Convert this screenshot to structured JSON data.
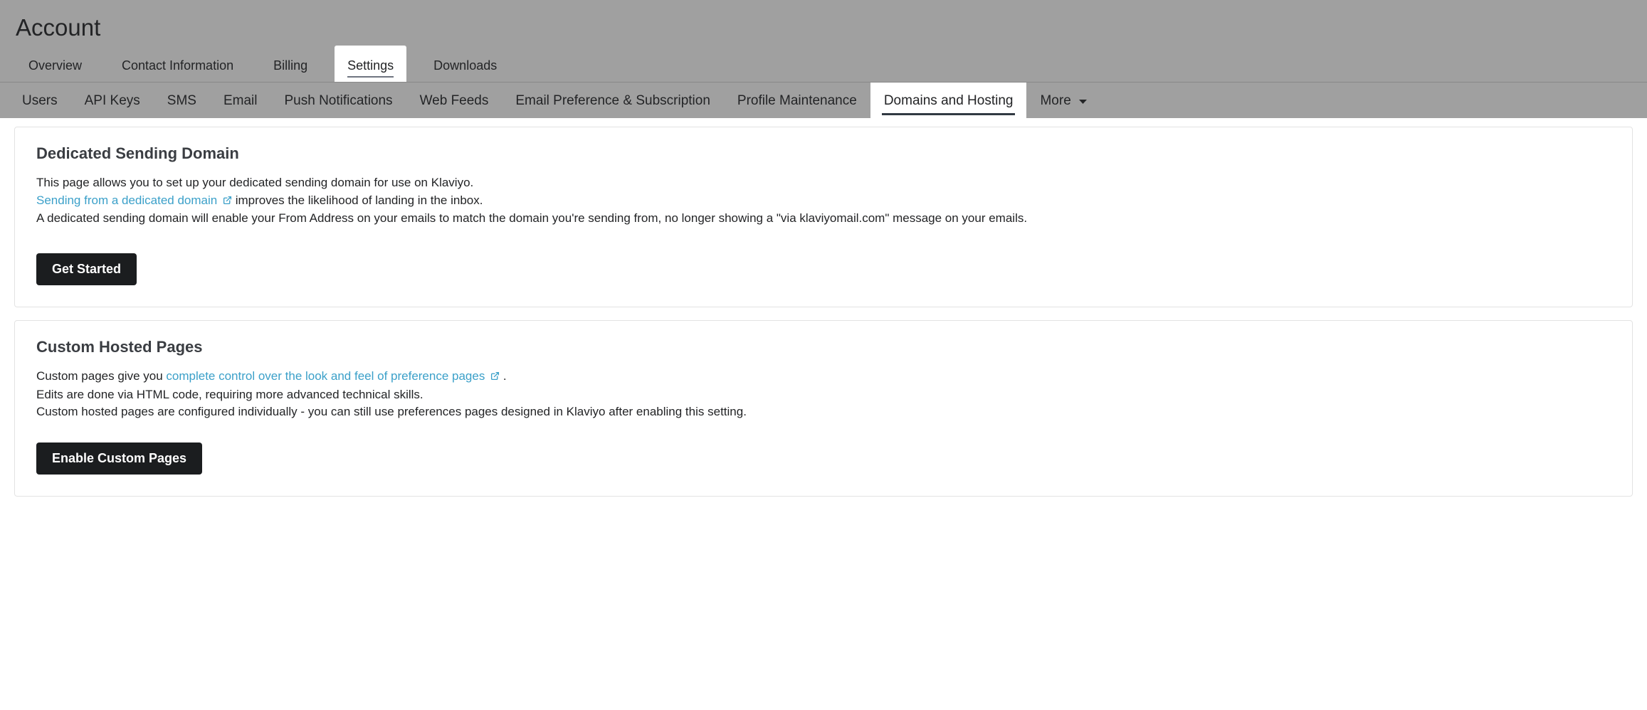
{
  "header": {
    "title": "Account"
  },
  "primary_tabs": {
    "items": [
      {
        "label": "Overview",
        "active": false
      },
      {
        "label": "Contact Information",
        "active": false
      },
      {
        "label": "Billing",
        "active": false
      },
      {
        "label": "Settings",
        "active": true
      },
      {
        "label": "Downloads",
        "active": false
      }
    ]
  },
  "secondary_tabs": {
    "items": [
      {
        "label": "Users",
        "active": false
      },
      {
        "label": "API Keys",
        "active": false
      },
      {
        "label": "SMS",
        "active": false
      },
      {
        "label": "Email",
        "active": false
      },
      {
        "label": "Push Notifications",
        "active": false
      },
      {
        "label": "Web Feeds",
        "active": false
      },
      {
        "label": "Email Preference & Subscription",
        "active": false
      },
      {
        "label": "Profile Maintenance",
        "active": false
      },
      {
        "label": "Domains and Hosting",
        "active": true
      },
      {
        "label": "More",
        "active": false,
        "dropdown": true
      }
    ]
  },
  "panels": {
    "dedicated": {
      "title": "Dedicated Sending Domain",
      "line1": "This page allows you to set up your dedicated sending domain for use on Klaviyo.",
      "link_text": "Sending from a dedicated domain",
      "line2_after_link": " improves the likelihood of landing in the inbox.",
      "line3": "A dedicated sending domain will enable your From Address on your emails to match the domain you're sending from, no longer showing a \"via klaviyomail.com\" message on your emails.",
      "button": "Get Started"
    },
    "custom_pages": {
      "title": "Custom Hosted Pages",
      "line1_before_link": "Custom pages give you ",
      "link_text": "complete control over the look and feel of preference pages",
      "line1_after_link": ".",
      "line2": "Edits are done via HTML code, requiring more advanced technical skills.",
      "line3": "Custom hosted pages are configured individually - you can still use preferences pages designed in Klaviyo after enabling this setting.",
      "button": "Enable Custom Pages"
    }
  }
}
